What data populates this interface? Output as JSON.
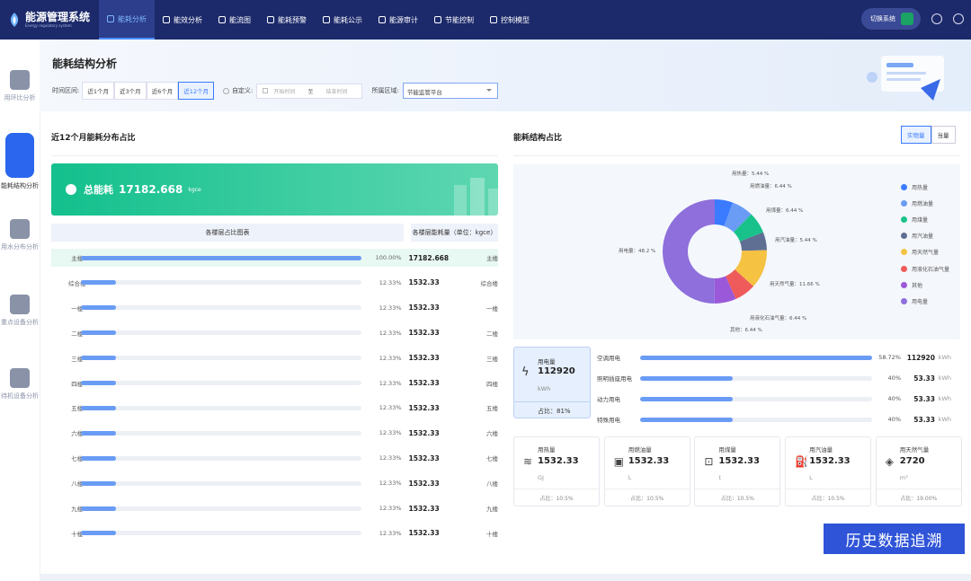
{
  "app": {
    "title": "能源管理系统",
    "subtitle": "Energy regulatory system"
  },
  "nav": [
    {
      "label": "能耗分析",
      "icon": "chart-icon",
      "active": true
    },
    {
      "label": "能效分析",
      "icon": "efficiency-icon"
    },
    {
      "label": "能流图",
      "icon": "flow-icon"
    },
    {
      "label": "能耗预警",
      "icon": "alert-icon"
    },
    {
      "label": "能耗公示",
      "icon": "publish-icon"
    },
    {
      "label": "能源审计",
      "icon": "audit-icon"
    },
    {
      "label": "节能控制",
      "icon": "control-icon"
    },
    {
      "label": "控制模型",
      "icon": "model-icon"
    }
  ],
  "topright": {
    "switch_label": "切换系统"
  },
  "sidebar": [
    {
      "label": "用环比分析",
      "icon": "ratio-icon"
    },
    {
      "label": "能耗结构分析",
      "icon": "pie-icon",
      "active": true
    },
    {
      "label": "用水分布分析",
      "icon": "water-drop-icon"
    },
    {
      "label": "重点设备分析",
      "icon": "equipment-icon"
    },
    {
      "label": "待机设备分析",
      "icon": "standby-icon"
    }
  ],
  "page": {
    "title": "能耗结构分析"
  },
  "filter": {
    "period_label": "时间区间:",
    "periods": [
      "近1个月",
      "近3个月",
      "近6个月",
      "近12个月"
    ],
    "custom_label": "自定义:",
    "start_placeholder": "开始时间",
    "to": "至",
    "end_placeholder": "结束时间",
    "area_label": "所属区域:",
    "area_value": "节能监管平台"
  },
  "left": {
    "title": "近12个月能耗分布占比",
    "total_label": "总能耗",
    "total_value": "17182.668",
    "total_unit": "kgce",
    "col1": "各楼层占比图表",
    "col2": "各楼层能耗量（单位：kgce）",
    "rows": [
      {
        "name": "主楼",
        "pct": "100.00%",
        "fill": 1.0,
        "value": "17182.668",
        "name2": "主楼"
      },
      {
        "name": "综合楼",
        "pct": "12.33%",
        "fill": 0.1233,
        "value": "1532.33",
        "name2": "综合楼"
      },
      {
        "name": "一楼",
        "pct": "12.33%",
        "fill": 0.1233,
        "value": "1532.33",
        "name2": "一楼"
      },
      {
        "name": "二楼",
        "pct": "12.33%",
        "fill": 0.1233,
        "value": "1532.33",
        "name2": "二楼"
      },
      {
        "name": "三楼",
        "pct": "12.33%",
        "fill": 0.1233,
        "value": "1532.33",
        "name2": "三楼"
      },
      {
        "name": "四楼",
        "pct": "12.33%",
        "fill": 0.1233,
        "value": "1532.33",
        "name2": "四楼"
      },
      {
        "name": "五楼",
        "pct": "12.33%",
        "fill": 0.1233,
        "value": "1532.33",
        "name2": "五楼"
      },
      {
        "name": "六楼",
        "pct": "12.33%",
        "fill": 0.1233,
        "value": "1532.33",
        "name2": "六楼"
      },
      {
        "name": "七楼",
        "pct": "12.33%",
        "fill": 0.1233,
        "value": "1532.33",
        "name2": "七楼"
      },
      {
        "name": "八楼",
        "pct": "12.33%",
        "fill": 0.1233,
        "value": "1532.33",
        "name2": "八楼"
      },
      {
        "name": "九楼",
        "pct": "12.33%",
        "fill": 0.1233,
        "value": "1532.33",
        "name2": "九楼"
      },
      {
        "name": "十楼",
        "pct": "12.33%",
        "fill": 0.1233,
        "value": "1532.33",
        "name2": "十楼"
      }
    ]
  },
  "right": {
    "title": "能耗结构占比",
    "toggle": [
      "实物量",
      "当量"
    ],
    "legend": [
      {
        "label": "用热量",
        "color": "#3a7bff"
      },
      {
        "label": "用燃油量",
        "color": "#6a9cf5"
      },
      {
        "label": "用煤量",
        "color": "#19c28a"
      },
      {
        "label": "用汽油量",
        "color": "#5f6f93"
      },
      {
        "label": "用天然气量",
        "color": "#f5c242"
      },
      {
        "label": "用液化石油气量",
        "color": "#ef5b5b"
      },
      {
        "label": "其他",
        "color": "#9b59d9"
      },
      {
        "label": "用电量",
        "color": "#8e6fdc"
      }
    ],
    "labels": {
      "heat": "用热量：5.44 %",
      "fuel": "用燃油量：6.44 %",
      "coal": "用煤量：6.44 %",
      "gasoline": "用汽油量：5.44 %",
      "gas": "用天然气量：11.66 %",
      "lpg": "用液化石油气量：6.44 %",
      "other": "其他：6.44 %",
      "elec": "用电量：48.2 %"
    }
  },
  "chart_data": {
    "type": "pie",
    "series": [
      {
        "name": "用热量",
        "value": 5.44
      },
      {
        "name": "用燃油量",
        "value": 6.44
      },
      {
        "name": "用煤量",
        "value": 6.44
      },
      {
        "name": "用汽油量",
        "value": 5.44
      },
      {
        "name": "用天然气量",
        "value": 11.66
      },
      {
        "name": "用液化石油气量",
        "value": 6.44
      },
      {
        "name": "其他",
        "value": 6.44
      },
      {
        "name": "用电量",
        "value": 48.2
      }
    ]
  },
  "electricity": {
    "label": "用电量",
    "value": "112920",
    "unit": "kWh",
    "ratio": "占比：81%",
    "rows": [
      {
        "name": "空调用电",
        "pct": "58.72%",
        "fill": 1.0,
        "value": "112920",
        "unit": "kWh"
      },
      {
        "name": "照明插座用电",
        "pct": "40%",
        "fill": 0.4,
        "value": "53.33",
        "unit": "kWh"
      },
      {
        "name": "动力用电",
        "pct": "40%",
        "fill": 0.4,
        "value": "53.33",
        "unit": "kWh"
      },
      {
        "name": "特殊用电",
        "pct": "40%",
        "fill": 0.4,
        "value": "53.33",
        "unit": "kWh"
      }
    ]
  },
  "cards": [
    {
      "label": "用热量",
      "value": "1532.33",
      "unit": "GJ",
      "ratio": "占比：10.5%",
      "icon": "heat-icon"
    },
    {
      "label": "用燃油量",
      "value": "1532.33",
      "unit": "L",
      "ratio": "占比：10.5%",
      "icon": "fuel-icon"
    },
    {
      "label": "用煤量",
      "value": "1532.33",
      "unit": "t",
      "ratio": "占比：10.5%",
      "icon": "coal-icon"
    },
    {
      "label": "用汽油量",
      "value": "1532.33",
      "unit": "L",
      "ratio": "占比：10.5%",
      "icon": "gasoline-icon"
    },
    {
      "label": "用天然气量",
      "value": "2720",
      "unit": "m³",
      "ratio": "占比：19.00%",
      "icon": "gas-flame-icon"
    }
  ],
  "history_button": "历史数据追溯"
}
